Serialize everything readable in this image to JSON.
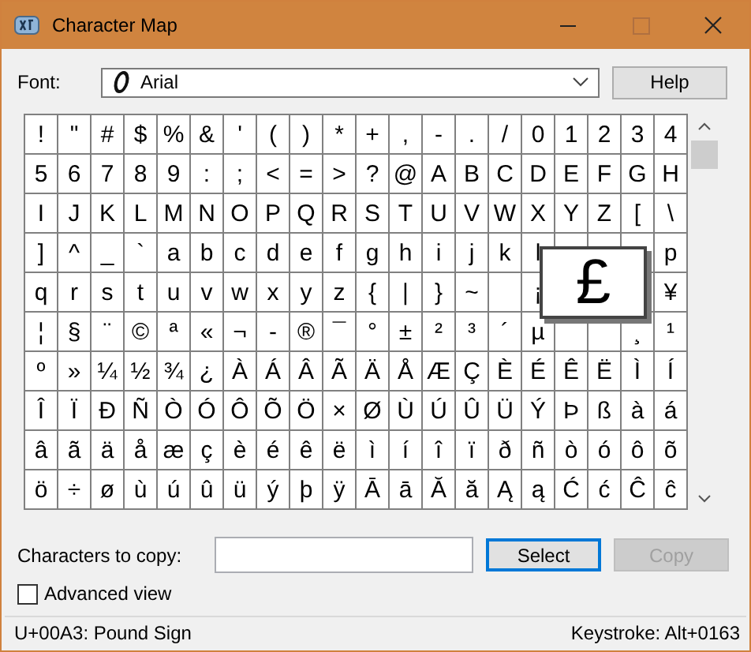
{
  "window": {
    "title": "Character Map"
  },
  "font": {
    "label": "Font:",
    "value": "Arial"
  },
  "help_button": {
    "label": "Help"
  },
  "grid": [
    [
      "!",
      "\"",
      "#",
      "$",
      "%",
      "&",
      "'",
      "(",
      ")",
      "*",
      "+",
      ",",
      "-",
      ".",
      "/",
      "0",
      "1",
      "2",
      "3",
      "4"
    ],
    [
      "5",
      "6",
      "7",
      "8",
      "9",
      ":",
      ";",
      "<",
      "=",
      ">",
      "?",
      "@",
      "A",
      "B",
      "C",
      "D",
      "E",
      "F",
      "G",
      "H"
    ],
    [
      "I",
      "J",
      "K",
      "L",
      "M",
      "N",
      "O",
      "P",
      "Q",
      "R",
      "S",
      "T",
      "U",
      "V",
      "W",
      "X",
      "Y",
      "Z",
      "[",
      "\\"
    ],
    [
      "]",
      "^",
      "_",
      "`",
      "a",
      "b",
      "c",
      "d",
      "e",
      "f",
      "g",
      "h",
      "i",
      "j",
      "k",
      "l",
      {
        "kind": "blank"
      },
      {
        "kind": "blank"
      },
      {
        "kind": "blank"
      },
      "p"
    ],
    [
      "q",
      "r",
      "s",
      "t",
      "u",
      "v",
      "w",
      "x",
      "y",
      "z",
      "{",
      "|",
      "}",
      "~",
      {
        "kind": "blank"
      },
      "¡",
      {
        "kind": "blank"
      },
      {
        "kind": "blank"
      },
      {
        "kind": "blank"
      },
      "¥"
    ],
    [
      "¦",
      "§",
      "¨",
      "©",
      "ª",
      "«",
      "¬",
      "-",
      "®",
      "¯",
      "°",
      "±",
      "²",
      "³",
      "´",
      "µ",
      {
        "kind": "blank"
      },
      {
        "kind": "blank"
      },
      "¸",
      "¹"
    ],
    [
      "º",
      "»",
      "¼",
      "½",
      "¾",
      "¿",
      "À",
      "Á",
      "Â",
      "Ã",
      "Ä",
      "Å",
      "Æ",
      "Ç",
      "È",
      "É",
      "Ê",
      "Ë",
      "Ì",
      "Í"
    ],
    [
      "Î",
      "Ï",
      "Ð",
      "Ñ",
      "Ò",
      "Ó",
      "Ô",
      "Õ",
      "Ö",
      "×",
      "Ø",
      "Ù",
      "Ú",
      "Û",
      "Ü",
      "Ý",
      "Þ",
      "ß",
      "à",
      "á"
    ],
    [
      "â",
      "ã",
      "ä",
      "å",
      "æ",
      "ç",
      "è",
      "é",
      "ê",
      "ë",
      "ì",
      "í",
      "î",
      "ï",
      "ð",
      "ñ",
      "ò",
      "ó",
      "ô",
      "õ"
    ],
    [
      "ö",
      "÷",
      "ø",
      "ù",
      "ú",
      "û",
      "ü",
      "ý",
      "þ",
      "ÿ",
      "Ā",
      "ā",
      "Ă",
      "ă",
      "Ą",
      "ą",
      "Ć",
      "ć",
      "Ĉ",
      "ĉ"
    ]
  ],
  "magnified": "£",
  "copy_field": {
    "label": "Characters to copy:"
  },
  "buttons": [
    {
      "label": "Select",
      "focused": true,
      "disabled": false
    },
    {
      "label": "Copy",
      "focused": false,
      "disabled": true
    }
  ],
  "advanced_view": {
    "label": "Advanced view",
    "checked": false
  },
  "status_bar": {
    "character": "U+00A3: Pound Sign",
    "keystroke": "Keystroke: Alt+0163"
  }
}
